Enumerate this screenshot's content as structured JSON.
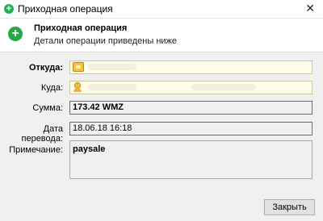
{
  "window": {
    "title": "Приходная операция",
    "close_glyph": "✕"
  },
  "header": {
    "title": "Приходная операция",
    "subtitle": "Детали операции приведены ниже",
    "icon": "plus-circle-icon"
  },
  "fields": {
    "from_label": "Откуда:",
    "to_label": "Куда:",
    "amount_label": "Сумма:",
    "amount_value": "173.42 WMZ",
    "date_label": "Дата перевода:",
    "date_value": "18.06.18 16:18",
    "note_label": "Примечание:",
    "note_value": "paysale"
  },
  "footer": {
    "close_label": "Закрыть"
  },
  "colors": {
    "accent_green": "#27a844",
    "yellow_field": "#fffde7"
  }
}
